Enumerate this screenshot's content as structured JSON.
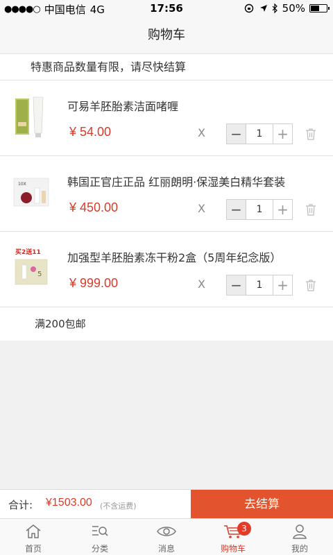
{
  "status_bar": {
    "carrier": "中国电信",
    "network": "4G",
    "time": "17:56",
    "battery": "50%"
  },
  "nav": {
    "title": "购物车"
  },
  "notice": "特惠商品数量有限，请尽快结算",
  "currency_prefix": "¥",
  "times_symbol": "X",
  "items": [
    {
      "title": "可易羊胚胎素洁面啫喱",
      "price": "¥ 54.00",
      "quantity": "1"
    },
    {
      "title": "韩国正官庄正品 红丽朗明·保湿美白精华套装",
      "price": "¥ 450.00",
      "quantity": "1"
    },
    {
      "title": "加强型羊胚胎素冻干粉2盒（5周年纪念版）",
      "price": "¥ 999.00",
      "quantity": "1",
      "promo_text": "买2送11"
    }
  ],
  "shipping_note": "满200包邮",
  "checkout": {
    "total_label": "合计:",
    "total_amount": "¥1503.00",
    "total_note": "(不含运费)",
    "button_label": "去结算"
  },
  "tabs": [
    {
      "label": "首页",
      "icon": "home-icon"
    },
    {
      "label": "分类",
      "icon": "category-search-icon"
    },
    {
      "label": "消息",
      "icon": "eye-icon"
    },
    {
      "label": "购物车",
      "icon": "cart-icon",
      "badge": "3",
      "active": true
    },
    {
      "label": "我的",
      "icon": "user-icon"
    }
  ],
  "colors": {
    "accent": "#e2532e",
    "price": "#d83b2a"
  }
}
